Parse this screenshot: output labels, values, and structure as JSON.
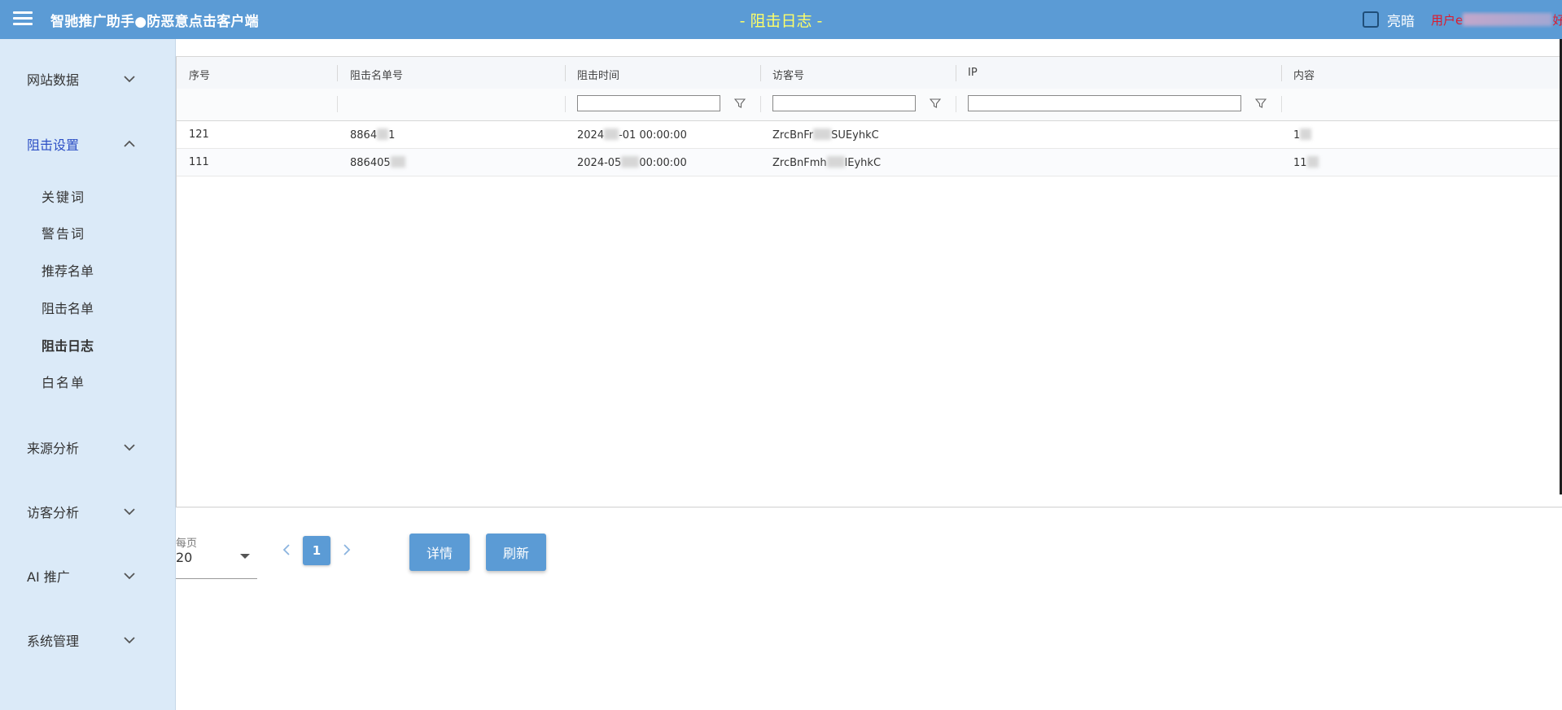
{
  "app": {
    "title": "智驰推广助手●防恶意点击客户端",
    "page_title": "- 阻击日志 -",
    "theme_label": "亮暗",
    "user_prefix": "用户e",
    "user_suffix": "好!"
  },
  "sidebar": {
    "groups": [
      {
        "label": "网站数据"
      },
      {
        "label": "阻击设置"
      },
      {
        "label": "来源分析"
      },
      {
        "label": "访客分析"
      },
      {
        "label": "AI 推广"
      },
      {
        "label": "系统管理"
      }
    ],
    "sub_items": [
      {
        "label": "关键词"
      },
      {
        "label": "警告词"
      },
      {
        "label": "推荐名单"
      },
      {
        "label": "阻击名单"
      },
      {
        "label": "阻击日志"
      },
      {
        "label": "白名单"
      }
    ]
  },
  "table": {
    "columns": [
      "序号",
      "阻击名单号",
      "阻击时间",
      "访客号",
      "IP",
      "内容"
    ],
    "rows": [
      {
        "seq": "121",
        "blocked_a": "8864",
        "blocked_b": "1",
        "time_a": "2024",
        "time_b": "-01 00:00:00",
        "visitor_a": "ZrcBnFr",
        "visitor_b": "SUEyhkC",
        "ip": "",
        "content_a": "1",
        "content_b": ""
      },
      {
        "seq": "111",
        "blocked_a": "886405",
        "blocked_b": "",
        "time_a": "2024-05",
        "time_b": "00:00:00",
        "visitor_a": "ZrcBnFmh",
        "visitor_b": "lEyhkC",
        "ip": "",
        "content_a": "11",
        "content_b": ""
      }
    ]
  },
  "pager": {
    "page_size_label": "每页",
    "page_size": "20",
    "current_page": "1",
    "detail_button": "详情",
    "refresh_button": "刷新"
  },
  "colors": {
    "primary": "#5b9bd5",
    "sidebar_bg": "#dbeaf8",
    "title_yellow": "#ffff66",
    "user_red": "#e0192b",
    "active_nav": "#2c4fc5"
  }
}
